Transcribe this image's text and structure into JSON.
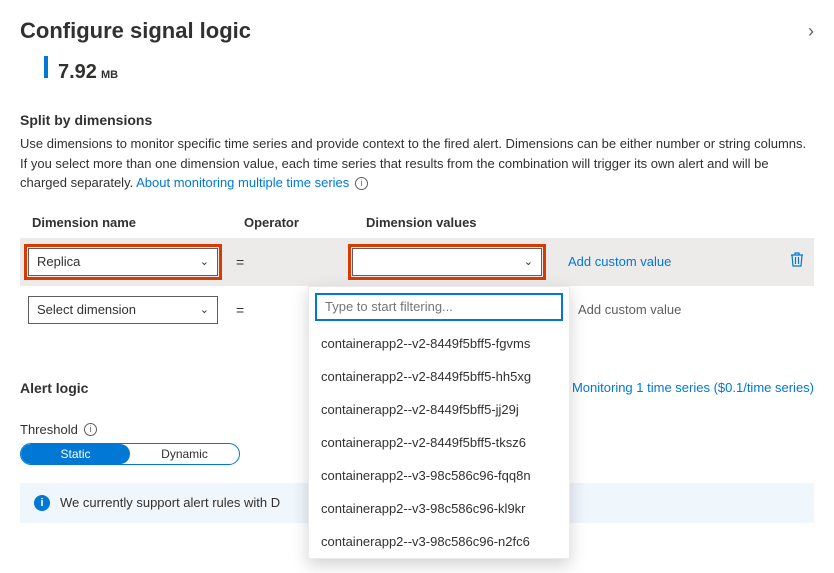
{
  "header": {
    "title": "Configure signal logic"
  },
  "metric": {
    "value": "7.92",
    "unit": "MB"
  },
  "split": {
    "title": "Split by dimensions",
    "description": "Use dimensions to monitor specific time series and provide context to the fired alert. Dimensions can be either number or string columns. If you select more than one dimension value, each time series that results from the combination will trigger its own alert and will be charged separately.",
    "link_text": "About monitoring multiple time series",
    "columns": {
      "name": "Dimension name",
      "operator": "Operator",
      "values": "Dimension values"
    },
    "rows": [
      {
        "name": "Replica",
        "operator": "=",
        "values": "",
        "add_label": "Add custom value",
        "deletable": true,
        "highlighted": true
      },
      {
        "name": "Select dimension",
        "operator": "=",
        "values": "",
        "add_label": "Add custom value",
        "deletable": false,
        "highlighted": false
      }
    ]
  },
  "dropdown": {
    "placeholder": "Type to start filtering...",
    "items": [
      "containerapp2--v2-8449f5bff5-fgvms",
      "containerapp2--v2-8449f5bff5-hh5xg",
      "containerapp2--v2-8449f5bff5-jj29j",
      "containerapp2--v2-8449f5bff5-tksz6",
      "containerapp2--v3-98c586c96-fqq8n",
      "containerapp2--v3-98c586c96-kl9kr",
      "containerapp2--v3-98c586c96-n2fc6"
    ]
  },
  "alert": {
    "title": "Alert logic",
    "monitoring_text": "Monitoring 1 time series ($0.1/time series)",
    "threshold_label": "Threshold",
    "toggle": {
      "static": "Static",
      "dynamic": "Dynamic"
    },
    "banner": "We currently support alert rules with D"
  }
}
